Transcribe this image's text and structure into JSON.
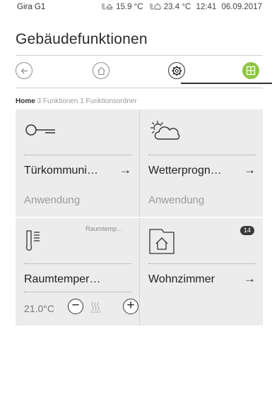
{
  "statusbar": {
    "device": "Gira G1",
    "outdoor_temp": "15.9 °C",
    "indoor_temp": "23.4 °C",
    "time": "12:41",
    "date": "06.09.2017"
  },
  "page": {
    "title": "Gebäudefunktionen"
  },
  "breadcrumb": {
    "home": "Home",
    "functions_count": "3",
    "functions_label": "Funktionen",
    "folders_count": "1",
    "folders_label": "Funktionsordner"
  },
  "tiles": [
    {
      "label": "Türkommuni…",
      "arrow": "→",
      "subtitle": "Anwendung",
      "icon": "key-icon"
    },
    {
      "label": "Wetterprogn…",
      "arrow": "→",
      "subtitle": "Anwendung",
      "icon": "weather-sun-cloud-icon"
    },
    {
      "label": "Raumtemper…",
      "corner": "Raumtemp…",
      "value": "21.0°C",
      "minus": "−",
      "plus": "+",
      "icon": "thermometer-icon"
    },
    {
      "label": "Wohnzimmer",
      "arrow": "→",
      "badge": "14",
      "icon": "folder-home-icon"
    }
  ],
  "colors": {
    "accent_green": "#8dc63f",
    "tile_bg": "#ececec"
  }
}
